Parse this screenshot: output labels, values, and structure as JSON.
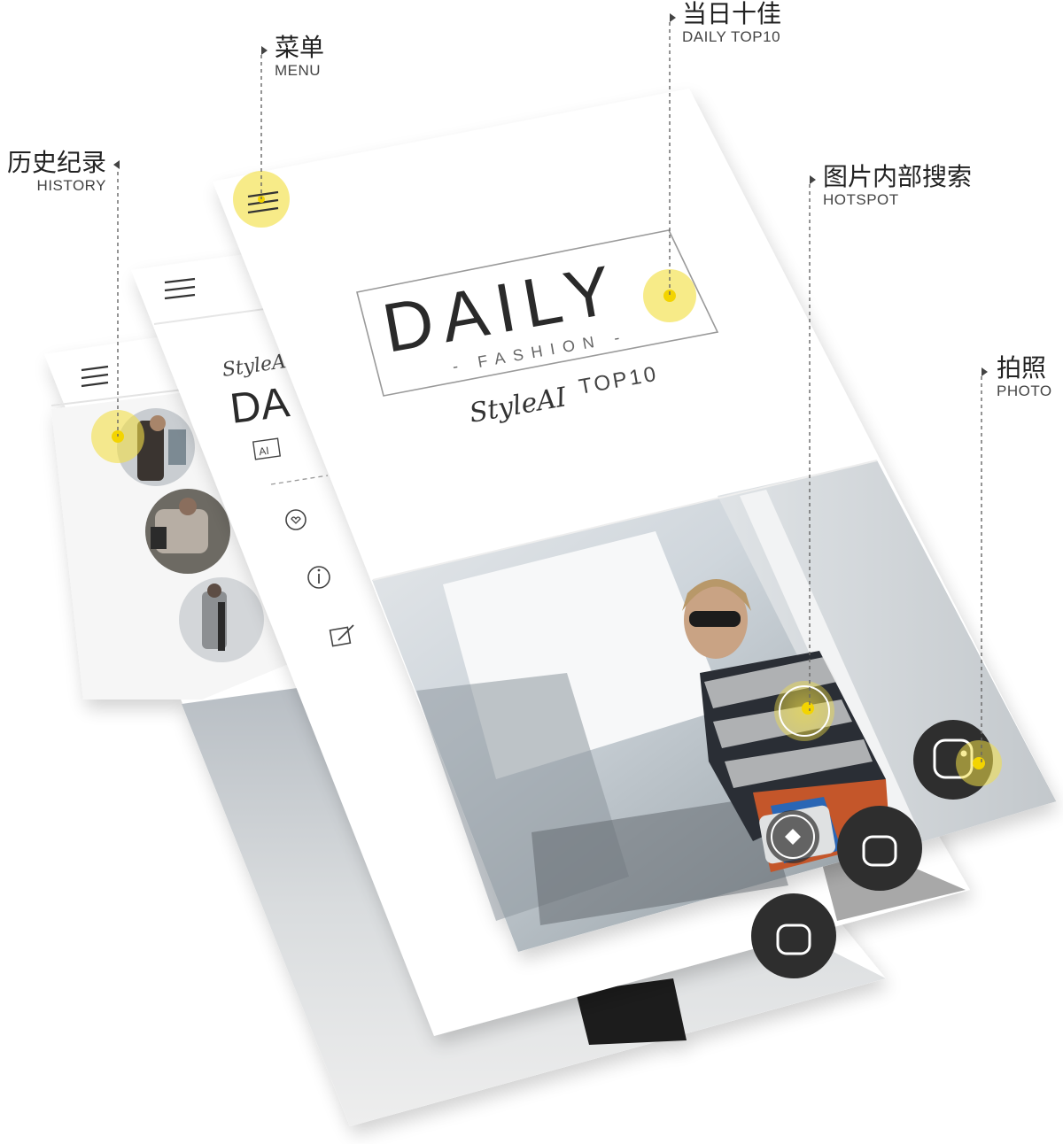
{
  "callouts": {
    "history": {
      "cn": "历史纪录",
      "en": "HISTORY"
    },
    "menu": {
      "cn": "菜单",
      "en": "MENU"
    },
    "daily_top10": {
      "cn": "当日十佳",
      "en": "DAILY TOP10"
    },
    "hotspot": {
      "cn": "图片内部搜索",
      "en": "HOTSPOT"
    },
    "photo": {
      "cn": "拍照",
      "en": "PHOTO"
    }
  },
  "front_screen": {
    "logo_word": "DAILY",
    "logo_sub": "- FASHION -",
    "brand_script": "StyleAI",
    "brand_tag": "TOP10"
  },
  "middle_screen": {
    "brand_script": "StyleAI",
    "logo_fragment": "DA",
    "ai_badge": "AI",
    "menu_items": [
      "favorite-icon",
      "info-icon",
      "edit-icon"
    ]
  },
  "back_screen": {
    "history_items": 3
  },
  "colors": {
    "highlight": "#f5e24a",
    "highlight_soft": "#f7ec9a",
    "camera_button": "#2e2e2e",
    "frame_border": "#9a9a9a"
  }
}
